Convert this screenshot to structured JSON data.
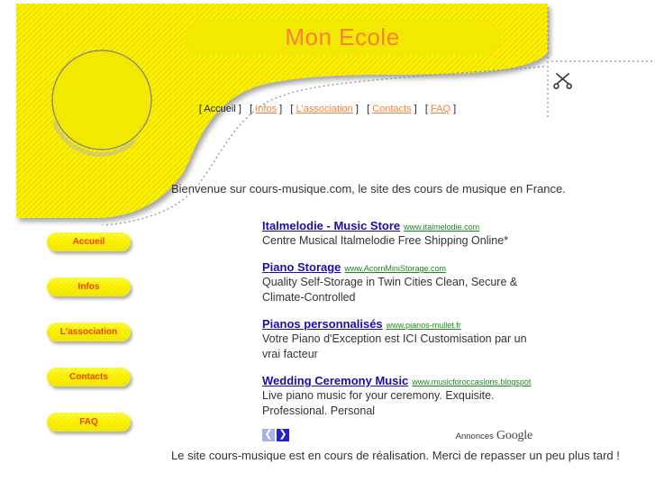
{
  "header": {
    "site_title": "Mon Ecole",
    "title_color": "#f5813a",
    "banner_color": "#fbf200",
    "scissors_icon": "scissors-icon"
  },
  "topnav": {
    "bracket_open": "[",
    "bracket_close": "]",
    "items": [
      {
        "label": "Accueil",
        "current": true
      },
      {
        "label": "Infos",
        "current": false
      },
      {
        "label": "L'association",
        "current": false
      },
      {
        "label": "Contacts",
        "current": false
      },
      {
        "label": "FAQ",
        "current": false
      }
    ]
  },
  "welcome": {
    "text": "Bienvenue sur cours-musique.com, le site des cours de musique en France."
  },
  "sidebar": {
    "items": [
      {
        "label": "Accueil"
      },
      {
        "label": "Infos"
      },
      {
        "label": "L'association"
      },
      {
        "label": "Contacts"
      },
      {
        "label": "FAQ"
      }
    ]
  },
  "ads": {
    "items": [
      {
        "title": "Italmelodie - Music Store",
        "url": "www.italmelodie.com",
        "description": "Centre Musical Italmelodie Free Shipping Online*"
      },
      {
        "title": "Piano Storage",
        "url": "www.AcornMiniStorage.com",
        "description": "Quality Self-Storage in Twin Cities Clean, Secure & Climate-Controlled"
      },
      {
        "title": "Pianos personnalisés",
        "url": "www.pianos-mullet.fr",
        "description": "Votre Piano d'Exception est ICI Customisation par un vrai facteur"
      },
      {
        "title": "Wedding Ceremony Music",
        "url": "www.musicforoccasions.blogspot",
        "description": "Live piano music for your ceremony. Exquisite. Professional. Personal"
      }
    ],
    "prev_arrow": "❮",
    "next_arrow": "❯",
    "branding_label": "Annonces",
    "branding_name": "Google"
  },
  "footer": {
    "text": "Le site cours-musique est en cours de réalisation. Merci de repasser un peu plus tard !"
  }
}
